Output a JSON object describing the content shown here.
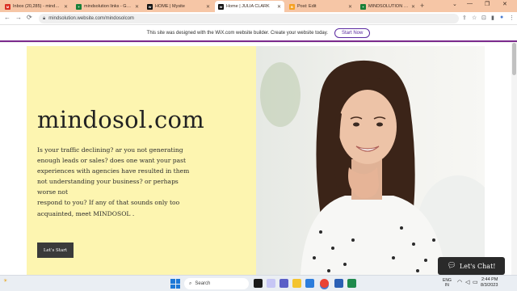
{
  "browser": {
    "tabs": [
      {
        "label": "Inbox (20,285) - mindsolut...",
        "fav_color": "#d93025",
        "fav_glyph": "M"
      },
      {
        "label": "mindsolution links - Goog...",
        "fav_color": "#188038",
        "fav_glyph": "+"
      },
      {
        "label": "HOME | Mysite",
        "fav_color": "#111111",
        "fav_glyph": "W"
      },
      {
        "label": "Home | JULIA CLARK",
        "fav_color": "#111111",
        "fav_glyph": "W"
      },
      {
        "label": "Post: Edit",
        "fav_color": "#f6a020",
        "fav_glyph": "B"
      },
      {
        "label": "MINDSOLUTION PVT LTD",
        "fav_color": "#188038",
        "fav_glyph": "+"
      }
    ],
    "new_tab": "+",
    "window_controls": [
      "⌄",
      "—",
      "❐",
      "✕"
    ],
    "nav": [
      "←",
      "→",
      "⟳"
    ],
    "url": "mindsolution.website.com/mindosolcom",
    "tools": [
      "⇪",
      "☆",
      "⊡",
      "▮",
      "●",
      "⋮"
    ]
  },
  "wix_banner": {
    "message": "This site was designed with the WiX.com website builder. Create your website today.",
    "button": "Start Now"
  },
  "hero": {
    "title": "mindosol.com",
    "paragraph_lines": [
      "Is your traffic declining? ar you not generating",
      "enough leads or sales? does one want your past",
      "experiences with agencies have resulted in them",
      "not understanding your business? or perhaps",
      "worse not",
      "respond to you? If any of that sounds only too",
      "acquainted, meet MINDOSOL ."
    ],
    "cta": "Let's Start"
  },
  "chat": {
    "label": "Let's Chat!"
  },
  "taskbar": {
    "search_placeholder": "Search",
    "lang": "ENG",
    "lang_region": "IN",
    "time": "2:44 PM",
    "date": "8/3/2023"
  },
  "colors": {
    "tabstrip": "#f6c6a6",
    "hero_bg": "#fdf5b0",
    "wix_accent": "#7b2a8c"
  }
}
